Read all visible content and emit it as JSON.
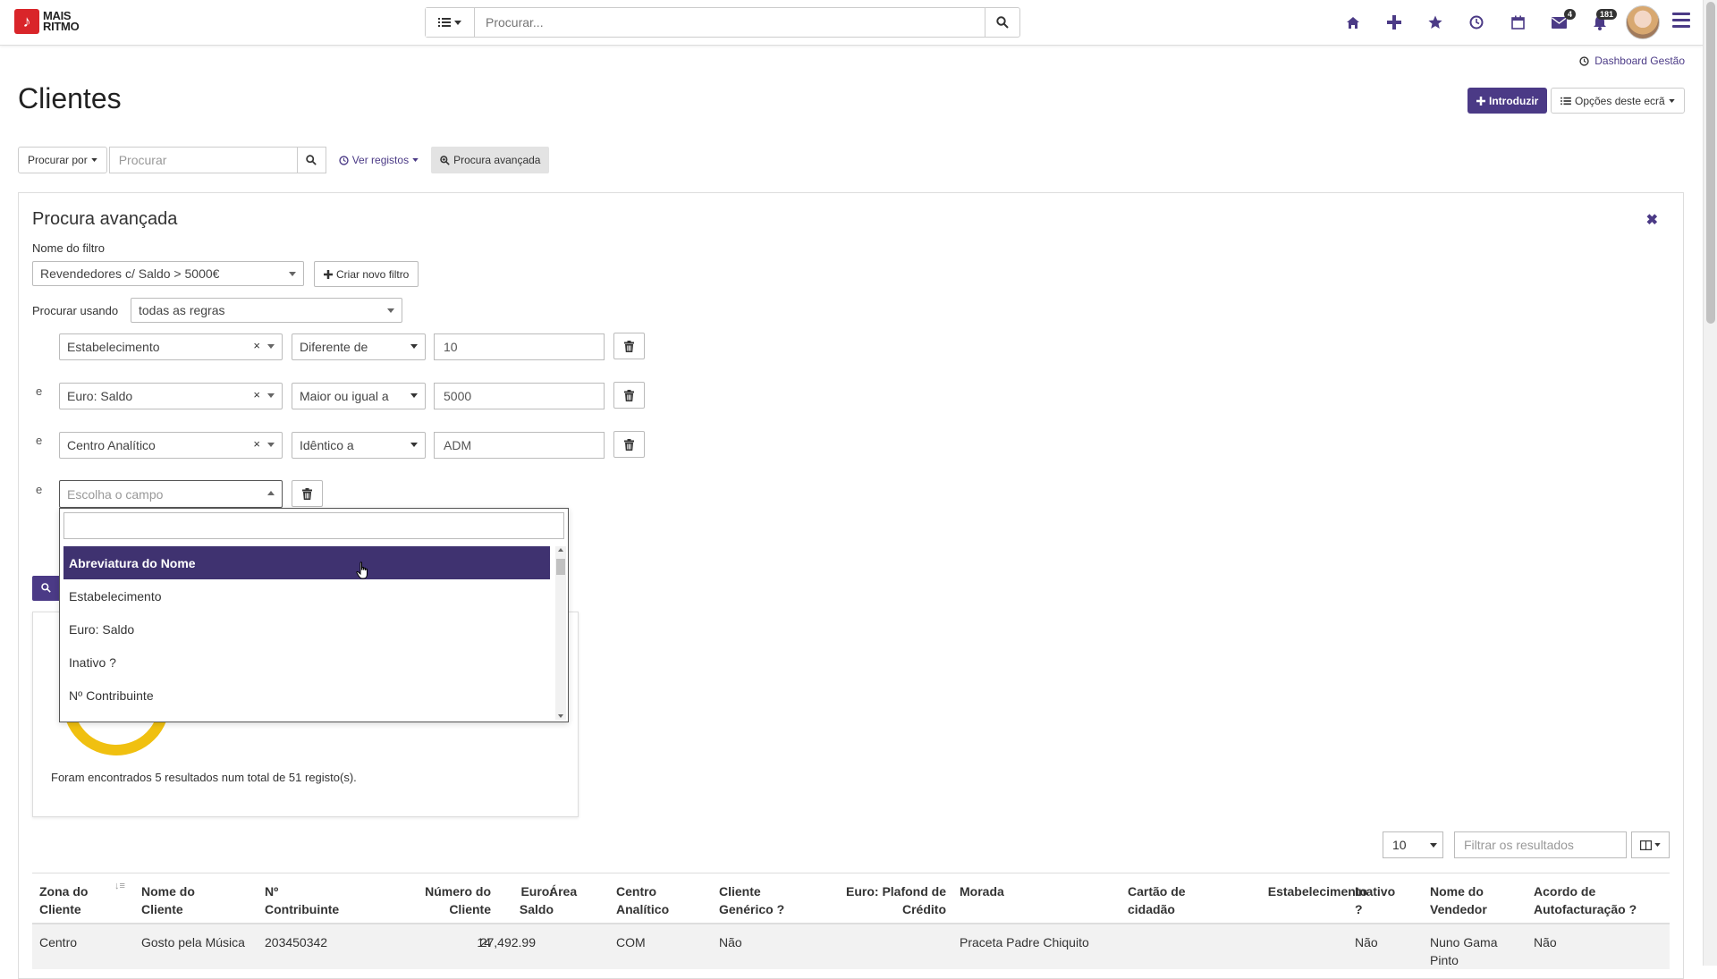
{
  "nav": {
    "logo_line1": "MAIS",
    "logo_line2": "RITMO",
    "search_placeholder": "Procurar...",
    "mail_badge": "4",
    "notif_badge": "181"
  },
  "header": {
    "dashboard_link": "Dashboard Gestão",
    "title": "Clientes",
    "introduce_btn": "Introduzir",
    "options_btn": "Opções deste ecrã"
  },
  "toolbar": {
    "search_by": "Procurar por",
    "search_placeholder": "Procurar",
    "view_records": "Ver registos",
    "advanced_search": "Procura avançada"
  },
  "advanced": {
    "title": "Procura avançada",
    "filter_name_label": "Nome do filtro",
    "filter_name_value": "Revendedores c/ Saldo > 5000€",
    "new_filter_btn": "Criar novo filtro",
    "search_using_label": "Procurar usando",
    "search_using_value": "todas as regras",
    "rules": [
      {
        "connector": "",
        "field": "Estabelecimento",
        "operator": "Diferente de",
        "value": "10"
      },
      {
        "connector": "e",
        "field": "Euro: Saldo",
        "operator": "Maior ou igual a",
        "value": "5000"
      },
      {
        "connector": "e",
        "field": "Centro Analítico",
        "operator": "Idêntico a",
        "value": "ADM"
      },
      {
        "connector": "e",
        "field_placeholder": "Escolha o campo"
      }
    ],
    "dropdown_items": [
      "Abreviatura do Nome",
      "Estabelecimento",
      "Euro: Saldo",
      "Inativo ?",
      "Nº Contribuinte"
    ],
    "results_text": "Foram encontrados 5 resultados num total de 51 registo(s)."
  },
  "table": {
    "page_size": "10",
    "filter_placeholder": "Filtrar os resultados",
    "columns": [
      [
        "Zona do",
        "Cliente"
      ],
      [
        "Nome do",
        "Cliente"
      ],
      [
        "Nº",
        "Contribuinte"
      ],
      [
        "Número do",
        "Cliente"
      ],
      [
        "Euro:",
        "Saldo"
      ],
      [
        "",
        "Área"
      ],
      [
        "Centro",
        "Analítico"
      ],
      [
        "Cliente",
        "Genérico ?"
      ],
      [
        "Euro: Plafond de",
        "Crédito"
      ],
      [
        "",
        "Morada"
      ],
      [
        "Cartão de",
        "cidadão"
      ],
      [
        "",
        "Estabelecimento"
      ],
      [
        "Inativo",
        "?"
      ],
      [
        "Nome do",
        "Vendedor"
      ],
      [
        "Acordo de",
        "Autofacturação ?"
      ]
    ],
    "rows": [
      {
        "zona": "Centro",
        "nome": "Gosto pela Música",
        "contribuinte": "203450342",
        "numero": "14",
        "saldo": "27,492.99",
        "area": "",
        "centro": "COM",
        "generico": "Não",
        "plafond": "",
        "morada": "Praceta Padre Chiquito",
        "cartao": "",
        "estabelecimento": "",
        "inativo": "Não",
        "vendedor_1": "Nuno Gama",
        "vendedor_2": "Pinto",
        "acordo": "Não"
      }
    ]
  },
  "colors": {
    "brand": "#4b3a86",
    "logo_red": "#d9252a",
    "donut": "#f0c010"
  }
}
